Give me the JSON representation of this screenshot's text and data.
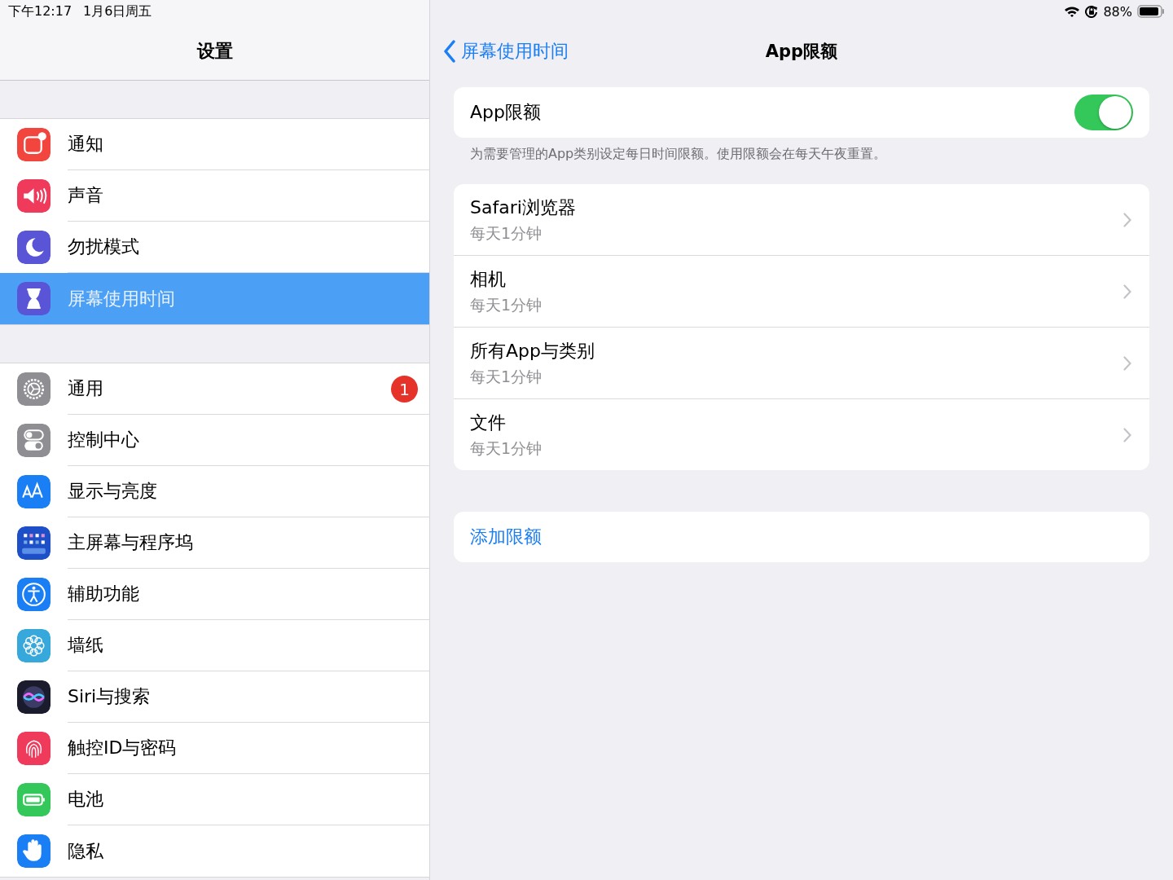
{
  "status_bar": {
    "time": "下午12:17",
    "date": "1月6日周五",
    "battery": "88%"
  },
  "sidebar": {
    "title": "设置",
    "groups": [
      [
        {
          "label": "通知",
          "selected": false
        },
        {
          "label": "声音",
          "selected": false
        },
        {
          "label": "勿扰模式",
          "selected": false
        },
        {
          "label": "屏幕使用时间",
          "selected": true
        }
      ],
      [
        {
          "label": "通用",
          "selected": false,
          "badge": "1"
        },
        {
          "label": "控制中心",
          "selected": false
        },
        {
          "label": "显示与亮度",
          "selected": false
        },
        {
          "label": "主屏幕与程序坞",
          "selected": false
        },
        {
          "label": "辅助功能",
          "selected": false
        },
        {
          "label": "墙纸",
          "selected": false
        },
        {
          "label": "Siri与搜索",
          "selected": false
        },
        {
          "label": "触控ID与密码",
          "selected": false
        },
        {
          "label": "电池",
          "selected": false
        },
        {
          "label": "隐私",
          "selected": false
        }
      ]
    ]
  },
  "detail": {
    "back": "屏幕使用时间",
    "title": "App限额",
    "toggle": {
      "label": "App限额",
      "on": true
    },
    "footer": "为需要管理的App类别设定每日时间限额。使用限额会在每天午夜重置。",
    "limits": [
      {
        "title": "Safari浏览器",
        "subtitle": "每天1分钟"
      },
      {
        "title": "相机",
        "subtitle": "每天1分钟"
      },
      {
        "title": "所有App与类别",
        "subtitle": "每天1分钟"
      },
      {
        "title": "文件",
        "subtitle": "每天1分钟"
      }
    ],
    "add_button": "添加限额"
  }
}
